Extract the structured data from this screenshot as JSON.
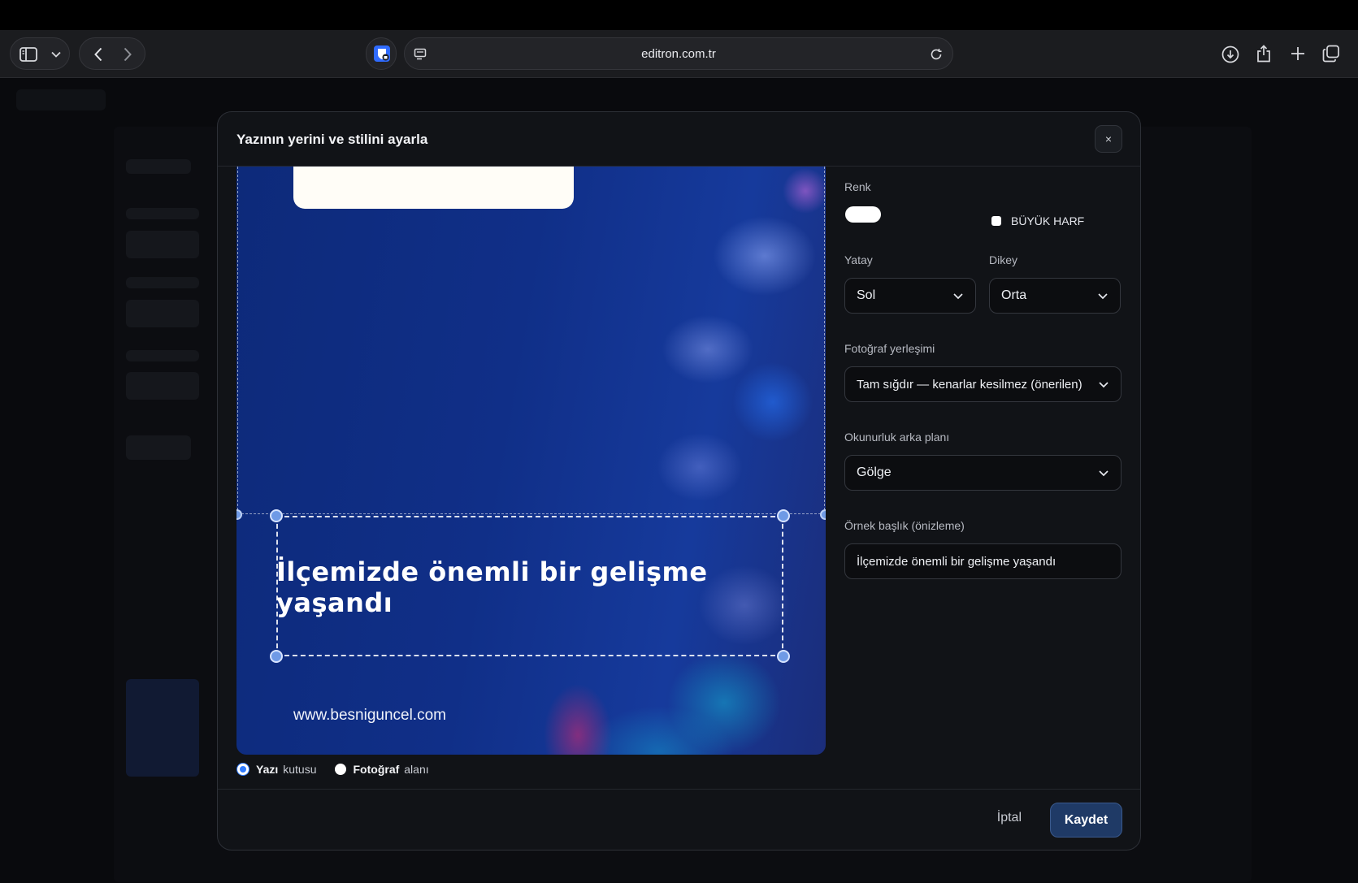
{
  "browser": {
    "url": "editron.com.tr",
    "icons": [
      "sidebar-icon",
      "chevron-down-icon",
      "back-icon",
      "forward-icon",
      "shield-extension-icon",
      "reader-icon",
      "reload-icon",
      "download-icon",
      "share-icon",
      "plus-icon",
      "tabs-icon"
    ]
  },
  "modal": {
    "title": "Yazının yerini ve stilini ayarla",
    "close_label": "×",
    "preview": {
      "headline": "İlçemizde önemli bir gelişme yaşandı",
      "site_url": "www.besniguncel.com"
    },
    "modes": [
      {
        "strong": "Yazı",
        "rest": "kutusu",
        "selected": true
      },
      {
        "strong": "Fotoğraf",
        "rest": "alanı",
        "selected": false
      }
    ],
    "settings": {
      "color_label": "Renk",
      "color_value": "#ffffff",
      "uppercase_label": "BÜYÜK HARF",
      "horizontal_label": "Yatay",
      "horizontal_value": "Sol",
      "vertical_label": "Dikey",
      "vertical_value": "Orta",
      "photo_fit_label": "Fotoğraf yerleşimi",
      "photo_fit_value": "Tam sığdır — kenarlar kesilmez (önerilen)",
      "readability_label": "Okunurluk arka planı",
      "readability_value": "Gölge",
      "sample_label": "Örnek başlık (önizleme)",
      "sample_value": "İlçemizde önemli bir gelişme yaşandı"
    },
    "footer": {
      "cancel_label": "İptal",
      "save_label": "Kaydet"
    }
  }
}
